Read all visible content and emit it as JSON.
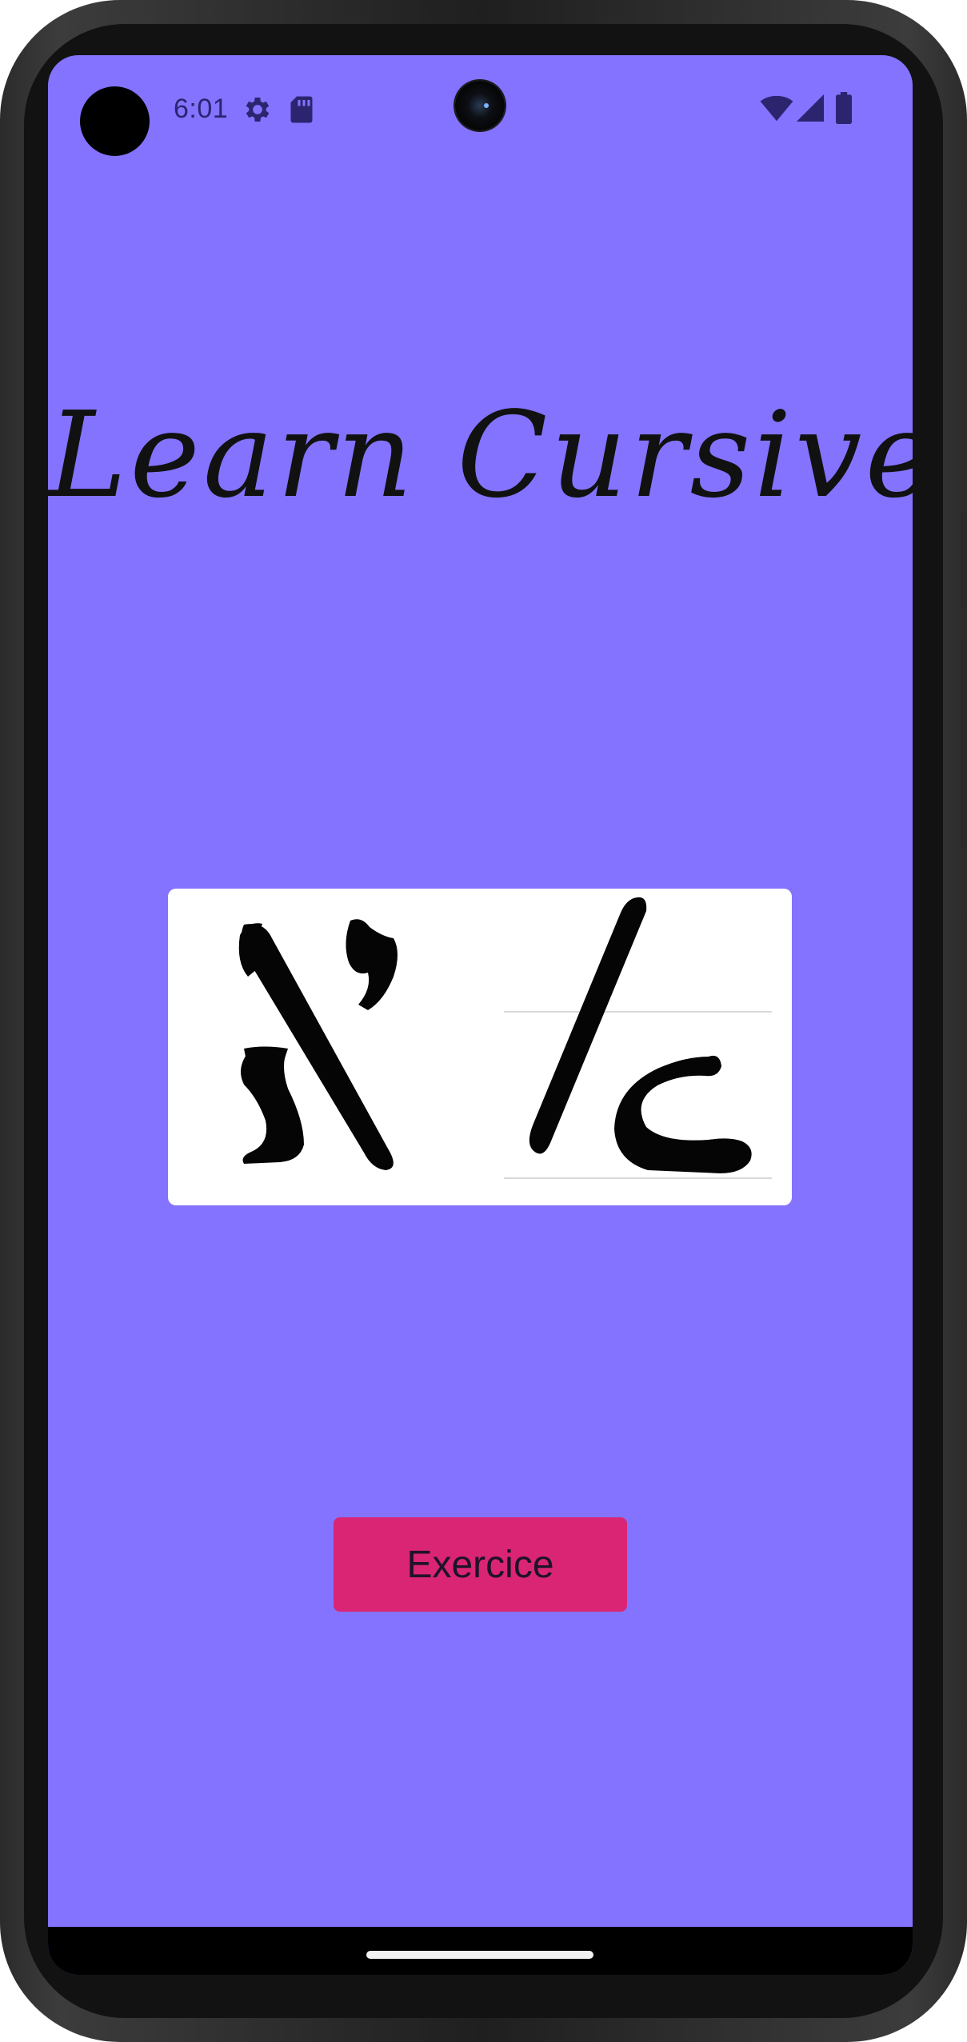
{
  "status_bar": {
    "time": "6:01",
    "icons": [
      "settings-icon",
      "sd-card-icon",
      "wifi-icon",
      "cellular-signal-icon",
      "battery-icon"
    ],
    "text_color": "#2d2470"
  },
  "app": {
    "title": "Learn Cursive",
    "background_color": "#8373fe",
    "letter_image": {
      "description_icon": "letter-aleph-image",
      "printed_letter": "א"
    },
    "button": {
      "label": "Exercice",
      "color": "#d92574"
    }
  }
}
